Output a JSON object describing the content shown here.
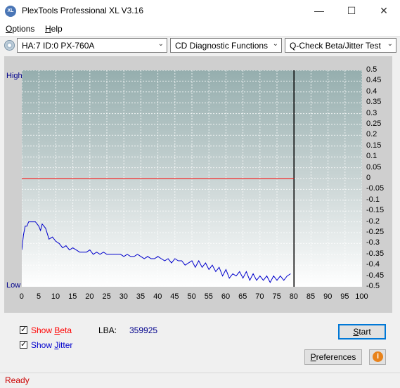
{
  "window": {
    "title": "PlexTools Professional XL V3.16",
    "icon_text": "XL"
  },
  "menu": [
    {
      "label": "Options",
      "underline": "O",
      "rest": "ptions"
    },
    {
      "label": "Help",
      "underline": "H",
      "rest": "elp"
    }
  ],
  "toolbar": {
    "drive": "HA:7 ID:0  PX-760A",
    "function": "CD Diagnostic Functions",
    "test": "Q-Check Beta/Jitter Test"
  },
  "chart_labels": {
    "high": "High",
    "low": "Low"
  },
  "chart_data": {
    "type": "line",
    "xlim": [
      0,
      100
    ],
    "ylim": [
      -0.5,
      0.5
    ],
    "x_ticks": [
      "0",
      "5",
      "10",
      "15",
      "20",
      "25",
      "30",
      "35",
      "40",
      "45",
      "50",
      "55",
      "60",
      "65",
      "70",
      "75",
      "80",
      "85",
      "90",
      "95",
      "100"
    ],
    "y_ticks": [
      "0.5",
      "0.45",
      "0.4",
      "0.35",
      "0.3",
      "0.25",
      "0.2",
      "0.15",
      "0.1",
      "0.05",
      "0",
      "-0.05",
      "-0.1",
      "-0.15",
      "-0.2",
      "-0.25",
      "-0.3",
      "-0.35",
      "-0.4",
      "-0.45",
      "-0.5"
    ],
    "end_marker_x": 80,
    "series": [
      {
        "color": "#ff0000",
        "x": [
          0,
          10,
          20,
          30,
          40,
          48,
          50,
          55,
          60,
          70,
          80
        ],
        "y": [
          0.0,
          0.0,
          0.0,
          0.0,
          0.0,
          0.0,
          0.0,
          0.0,
          0.0,
          0.0,
          0.0
        ]
      },
      {
        "color": "#0000cc",
        "x": [
          0,
          0.5,
          1,
          1.5,
          2,
          3,
          4,
          5,
          5.5,
          6,
          7,
          8,
          9,
          10,
          11,
          12,
          13,
          14,
          15,
          16,
          17,
          18,
          19,
          20,
          21,
          22,
          23,
          24,
          25,
          26,
          27,
          28,
          29,
          30,
          31,
          32,
          33,
          34,
          35,
          36,
          37,
          38,
          39,
          40,
          41,
          42,
          43,
          44,
          45,
          46,
          47,
          48,
          49,
          50,
          51,
          52,
          53,
          54,
          55,
          56,
          57,
          58,
          59,
          60,
          61,
          62,
          63,
          64,
          65,
          66,
          67,
          68,
          69,
          70,
          71,
          72,
          73,
          74,
          75,
          76,
          77,
          78,
          79
        ],
        "y": [
          -0.33,
          -0.26,
          -0.22,
          -0.22,
          -0.2,
          -0.2,
          -0.2,
          -0.22,
          -0.24,
          -0.21,
          -0.23,
          -0.28,
          -0.27,
          -0.29,
          -0.3,
          -0.32,
          -0.31,
          -0.33,
          -0.32,
          -0.33,
          -0.34,
          -0.34,
          -0.34,
          -0.33,
          -0.35,
          -0.34,
          -0.35,
          -0.34,
          -0.35,
          -0.35,
          -0.35,
          -0.35,
          -0.35,
          -0.36,
          -0.35,
          -0.36,
          -0.36,
          -0.35,
          -0.36,
          -0.37,
          -0.36,
          -0.37,
          -0.37,
          -0.36,
          -0.37,
          -0.38,
          -0.37,
          -0.39,
          -0.37,
          -0.38,
          -0.38,
          -0.4,
          -0.39,
          -0.38,
          -0.41,
          -0.38,
          -0.41,
          -0.39,
          -0.42,
          -0.4,
          -0.43,
          -0.41,
          -0.45,
          -0.42,
          -0.46,
          -0.44,
          -0.45,
          -0.43,
          -0.46,
          -0.43,
          -0.47,
          -0.44,
          -0.47,
          -0.45,
          -0.47,
          -0.45,
          -0.48,
          -0.45,
          -0.47,
          -0.45,
          -0.47,
          -0.45,
          -0.44
        ]
      }
    ]
  },
  "options": {
    "show_beta": {
      "prefix": "Show ",
      "hot": "B",
      "rest": "eta",
      "checked": true,
      "color": "#ff0000"
    },
    "show_jitter": {
      "prefix": "Show ",
      "hot": "J",
      "rest": "itter",
      "checked": true,
      "color": "#0000cc"
    }
  },
  "lba": {
    "label": "LBA:",
    "value": "359925"
  },
  "buttons": {
    "start": {
      "hot": "S",
      "rest": "tart"
    },
    "preferences": {
      "hot": "P",
      "rest": "references"
    }
  },
  "status": "Ready"
}
